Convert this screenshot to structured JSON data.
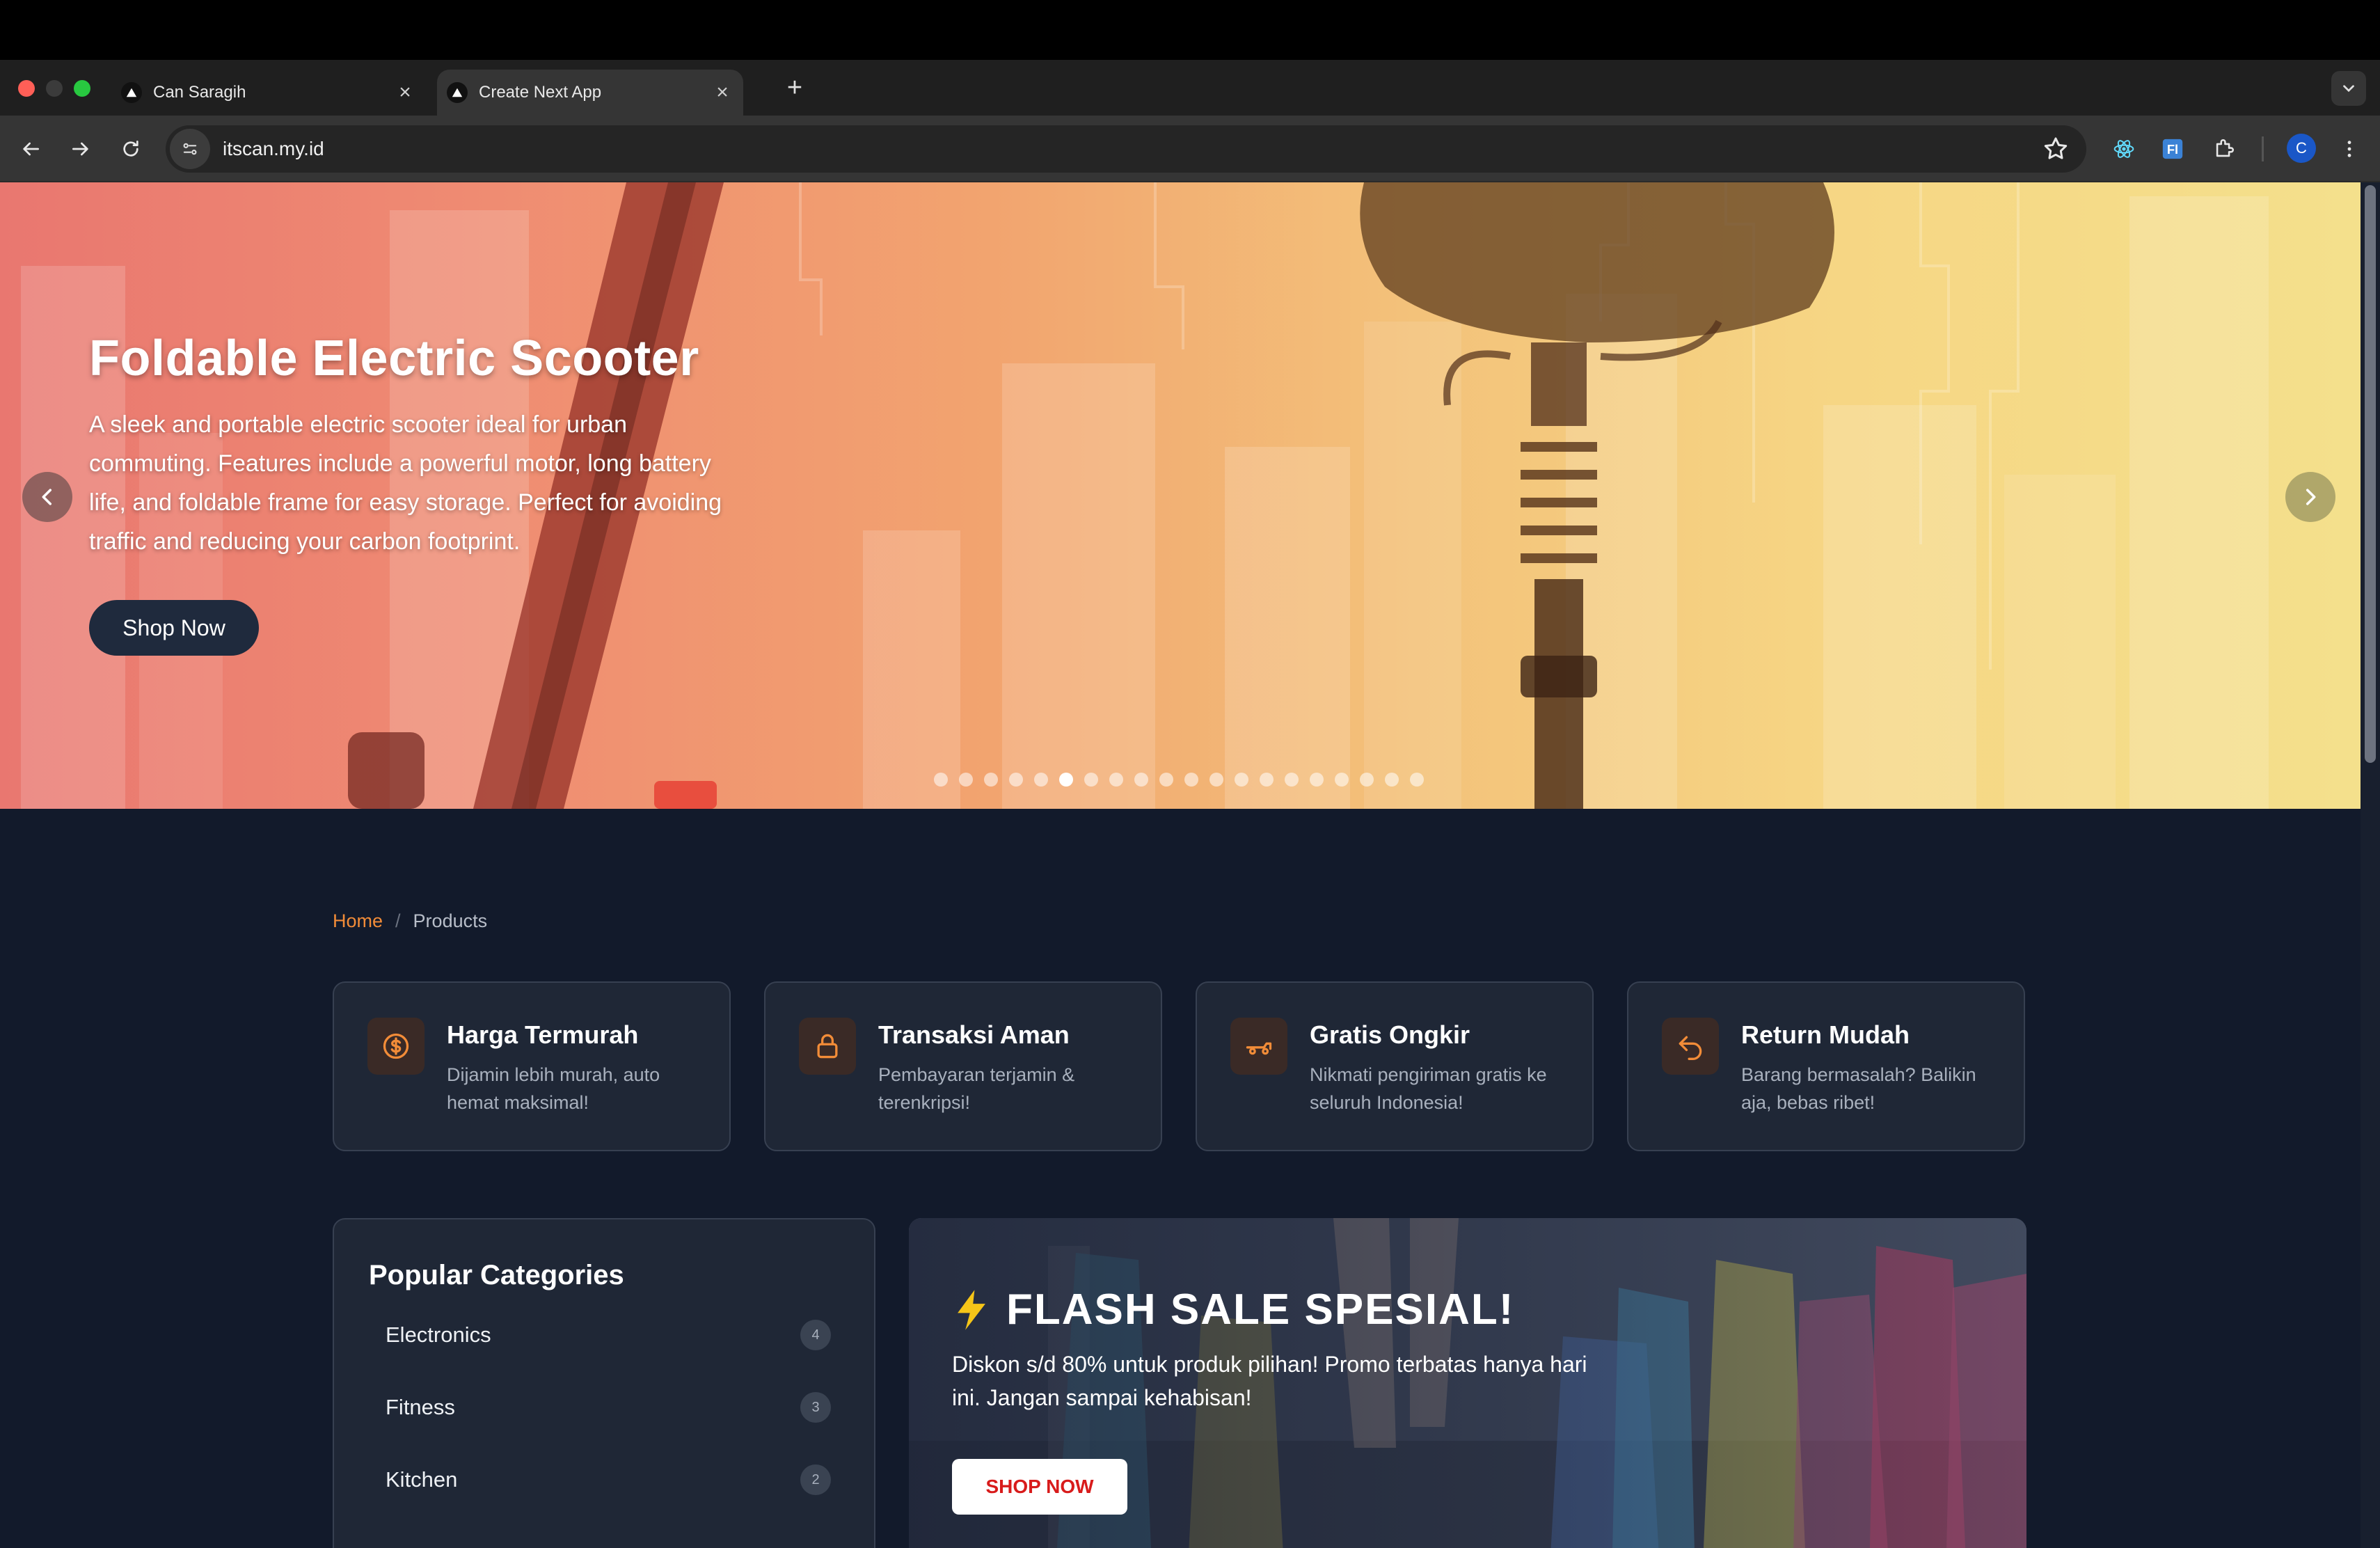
{
  "browser": {
    "tabs": [
      {
        "title": "Can Saragih",
        "active": false
      },
      {
        "title": "Create Next App",
        "active": true
      }
    ],
    "url": "itscan.my.id",
    "profile_initial": "C"
  },
  "hero": {
    "title": "Foldable Electric Scooter",
    "description": "A sleek and portable electric scooter ideal for urban commuting. Features include a powerful motor, long battery life, and foldable frame for easy storage. Perfect for avoiding traffic and reducing your carbon footprint.",
    "cta": "Shop Now",
    "slide_count": 20,
    "active_slide": 6
  },
  "breadcrumb": {
    "home": "Home",
    "separator": "/",
    "current": "Products"
  },
  "features": [
    {
      "icon": "dollar-icon",
      "title": "Harga Termurah",
      "desc": "Dijamin lebih murah, auto hemat maksimal!"
    },
    {
      "icon": "lock-icon",
      "title": "Transaksi Aman",
      "desc": "Pembayaran terjamin & terenkripsi!"
    },
    {
      "icon": "truck-icon",
      "title": "Gratis Ongkir",
      "desc": "Nikmati pengiriman gratis ke seluruh Indonesia!"
    },
    {
      "icon": "return-icon",
      "title": "Return Mudah",
      "desc": "Barang bermasalah? Balikin aja, bebas ribet!"
    }
  ],
  "categories": {
    "title": "Popular Categories",
    "items": [
      {
        "name": "Electronics",
        "count": "4"
      },
      {
        "name": "Fitness",
        "count": "3"
      },
      {
        "name": "Kitchen",
        "count": "2"
      }
    ]
  },
  "promo": {
    "title": "FLASH SALE SPESIAL!",
    "desc": "Diskon s/d 80% untuk produk pilihan! Promo terbatas hanya hari ini. Jangan sampai kehabisan!",
    "cta": "SHOP NOW"
  },
  "colors": {
    "accent": "#f28c38",
    "page_bg": "#121a2b",
    "card_bg": "#1f2736",
    "promo_cta": "#d81b1b"
  }
}
